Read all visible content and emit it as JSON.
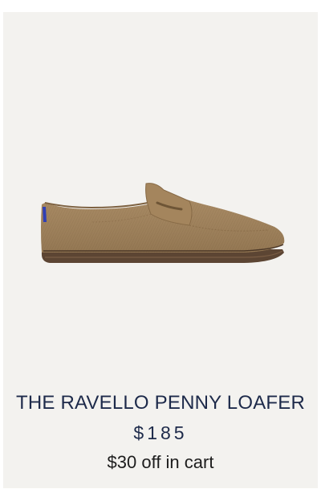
{
  "product": {
    "name": "THE RAVELLO PENNY LOAFER",
    "price": "$185",
    "promo": "$30 off in cart",
    "image_icon": "loafer-shoe-image"
  },
  "colors": {
    "card_background": "#f3f2ef",
    "title_color": "#1d2a4a",
    "shoe_body": "#a88a63",
    "shoe_sole": "#5c4533",
    "heel_tab": "#2f3fb5"
  }
}
